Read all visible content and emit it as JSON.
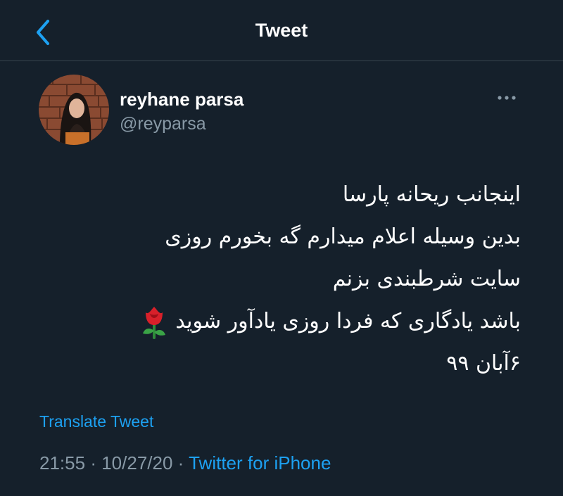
{
  "header": {
    "title": "Tweet",
    "back_icon": "chevron-left-icon"
  },
  "author": {
    "display_name": "reyhane parsa",
    "handle": "@reyparsa",
    "avatar": "profile-photo"
  },
  "more_icon": "more-horizontal-icon",
  "tweet": {
    "lines": [
      "اینجانب ریحانه پارسا",
      "بدین وسیله اعلام میدارم گه بخورم روزی",
      "سایت شرطبندی بزنم",
      "باشد یادگاری که فردا روزی یادآور شوید",
      "۶آبان ۹۹"
    ],
    "emoji": "rose-emoji"
  },
  "translate_label": "Translate Tweet",
  "meta": {
    "time": "21:55",
    "separator": "·",
    "date": "10/27/20",
    "source": "Twitter for iPhone"
  },
  "colors": {
    "background": "#15202b",
    "accent": "#1da1f2",
    "secondary_text": "#8899a6",
    "divider": "#38444d"
  }
}
